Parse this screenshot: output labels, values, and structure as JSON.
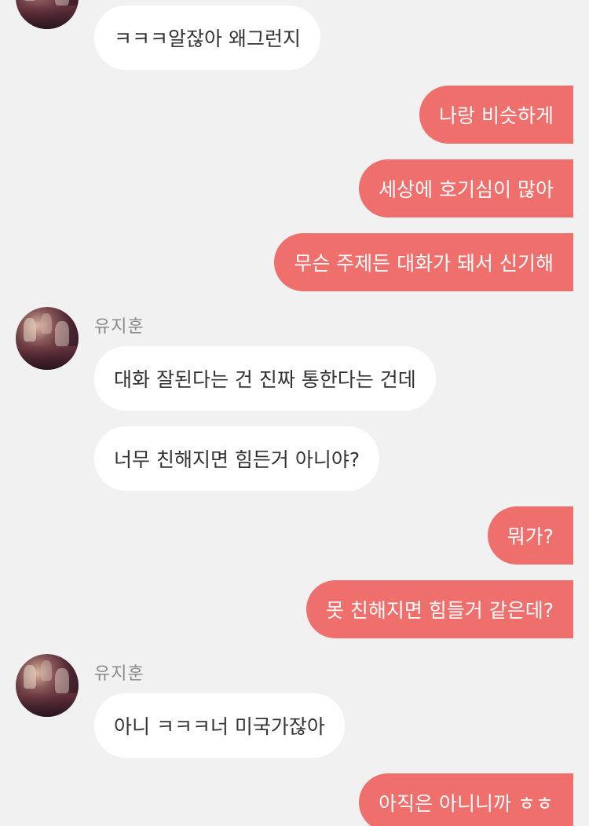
{
  "colors": {
    "background": "#f1f1f1",
    "incoming_bubble": "#ffffff",
    "outgoing_bubble": "#ef6f6c",
    "sender_name": "#8a8a8a"
  },
  "messages": [
    {
      "direction": "incoming",
      "text": "ㅋㅋㅋ알잖아 왜그런지"
    },
    {
      "direction": "outgoing",
      "text": "나랑 비슷하게"
    },
    {
      "direction": "outgoing",
      "text": "세상에 호기심이 많아"
    },
    {
      "direction": "outgoing",
      "text": "무슨 주제든 대화가 돼서 신기해"
    },
    {
      "direction": "incoming",
      "sender": "유지훈",
      "text": "대화 잘된다는 건 진짜 통한다는 건데"
    },
    {
      "direction": "incoming",
      "text": "너무 친해지면 힘든거 아니야?"
    },
    {
      "direction": "outgoing",
      "text": "뭐가?"
    },
    {
      "direction": "outgoing",
      "text": "못 친해지면 힘들거 같은데?"
    },
    {
      "direction": "incoming",
      "sender": "유지훈",
      "text": "아니 ㅋㅋㅋ너 미국가잖아"
    },
    {
      "direction": "outgoing",
      "text": "아직은 아니니까 ㅎㅎ"
    }
  ]
}
